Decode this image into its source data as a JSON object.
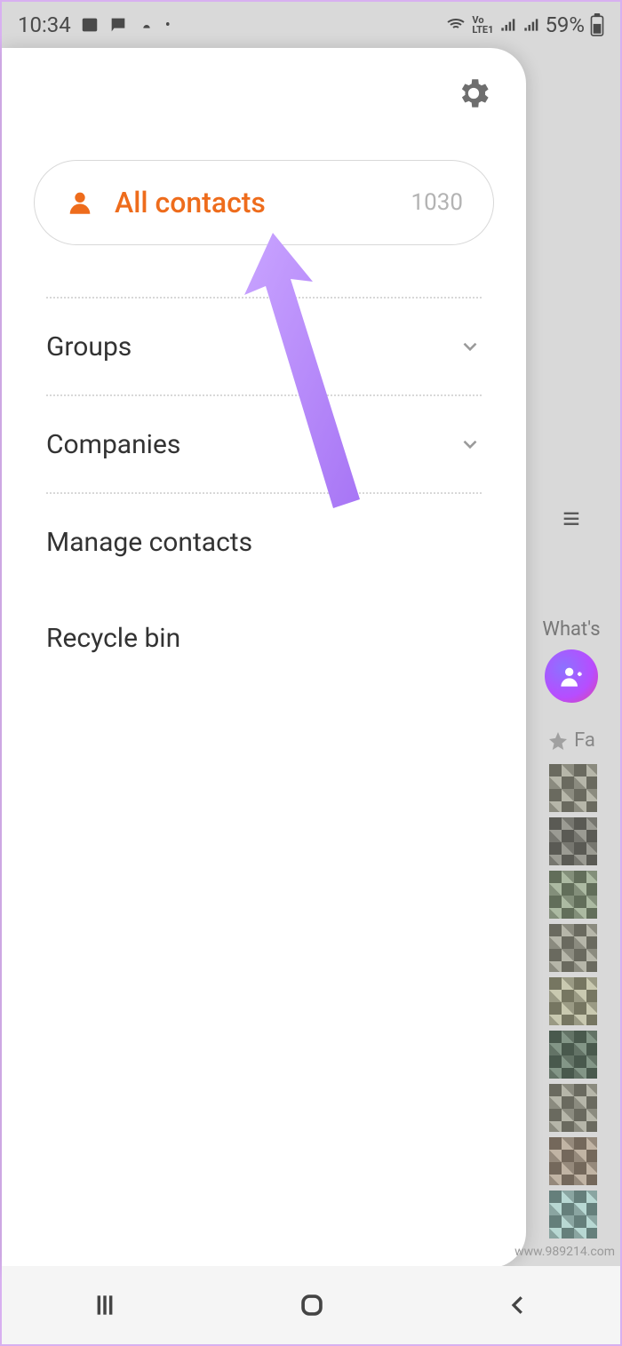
{
  "status": {
    "time": "10:34",
    "battery": "59%"
  },
  "drawer": {
    "all_contacts": {
      "label": "All contacts",
      "count": "1030"
    },
    "items": {
      "groups": "Groups",
      "companies": "Companies",
      "manage": "Manage contacts",
      "recycle": "Recycle bin"
    }
  },
  "background": {
    "whats": "What's",
    "fav": "Fa"
  },
  "watermark": "www.989214.com",
  "colors": {
    "accent": "#ee6c1c",
    "annotation": "#b68cff"
  }
}
